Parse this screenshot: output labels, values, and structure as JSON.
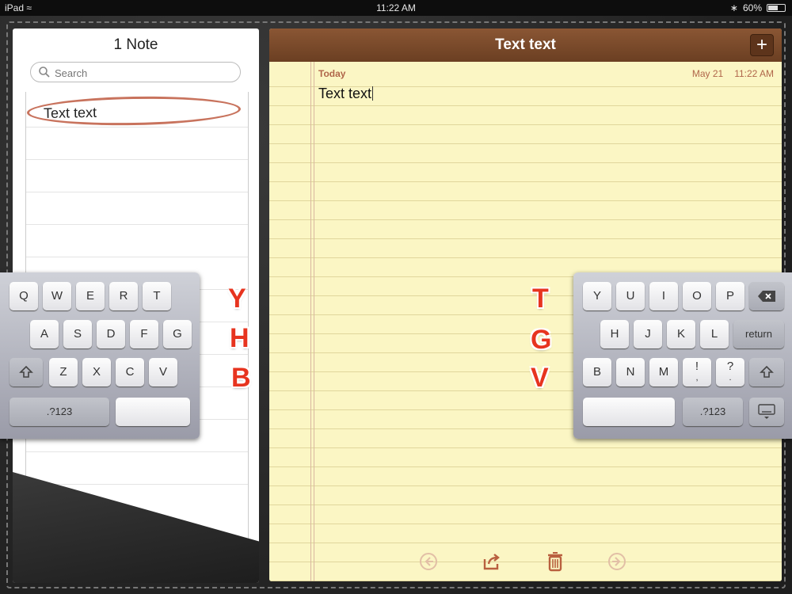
{
  "status_bar": {
    "device": "iPad",
    "time": "11:22 AM",
    "battery": "60%",
    "battery_level": 0.6
  },
  "notes_list": {
    "count_title": "1 Note",
    "search_placeholder": "Search",
    "items": [
      {
        "title": "Text text",
        "selected": true
      }
    ]
  },
  "note": {
    "title": "Text text",
    "date_label": "Today",
    "date": "May 21",
    "time": "11:22 AM",
    "body": "Text text",
    "add_label": "+"
  },
  "toolbar": {
    "icons": [
      "back-arrow-icon",
      "share-icon",
      "trash-icon",
      "forward-arrow-icon"
    ]
  },
  "keyboard": {
    "left": {
      "row1": [
        "Q",
        "W",
        "E",
        "R",
        "T"
      ],
      "row2": [
        "A",
        "S",
        "D",
        "F",
        "G"
      ],
      "row3": [
        "Z",
        "X",
        "C",
        "V"
      ],
      "numbers_label": ".?123"
    },
    "right": {
      "row1": [
        "Y",
        "U",
        "I",
        "O",
        "P"
      ],
      "row2": [
        "H",
        "J",
        "K",
        "L"
      ],
      "return_label": "return",
      "row3": [
        "B",
        "N",
        "M",
        "!",
        "?"
      ],
      "row3_sub": [
        "",
        "",
        "",
        ",",
        "."
      ],
      "numbers_label": ".?123"
    }
  },
  "hidden_key_hints": {
    "left": [
      "Y",
      "H",
      "B"
    ],
    "right": [
      "T",
      "G",
      "V"
    ]
  },
  "colors": {
    "hint_red": "#e7341f",
    "leather": "#2b2b2b",
    "paper": "#fbf6c4",
    "header_brown": "#7a4a2b",
    "date_text": "#b0664a"
  }
}
